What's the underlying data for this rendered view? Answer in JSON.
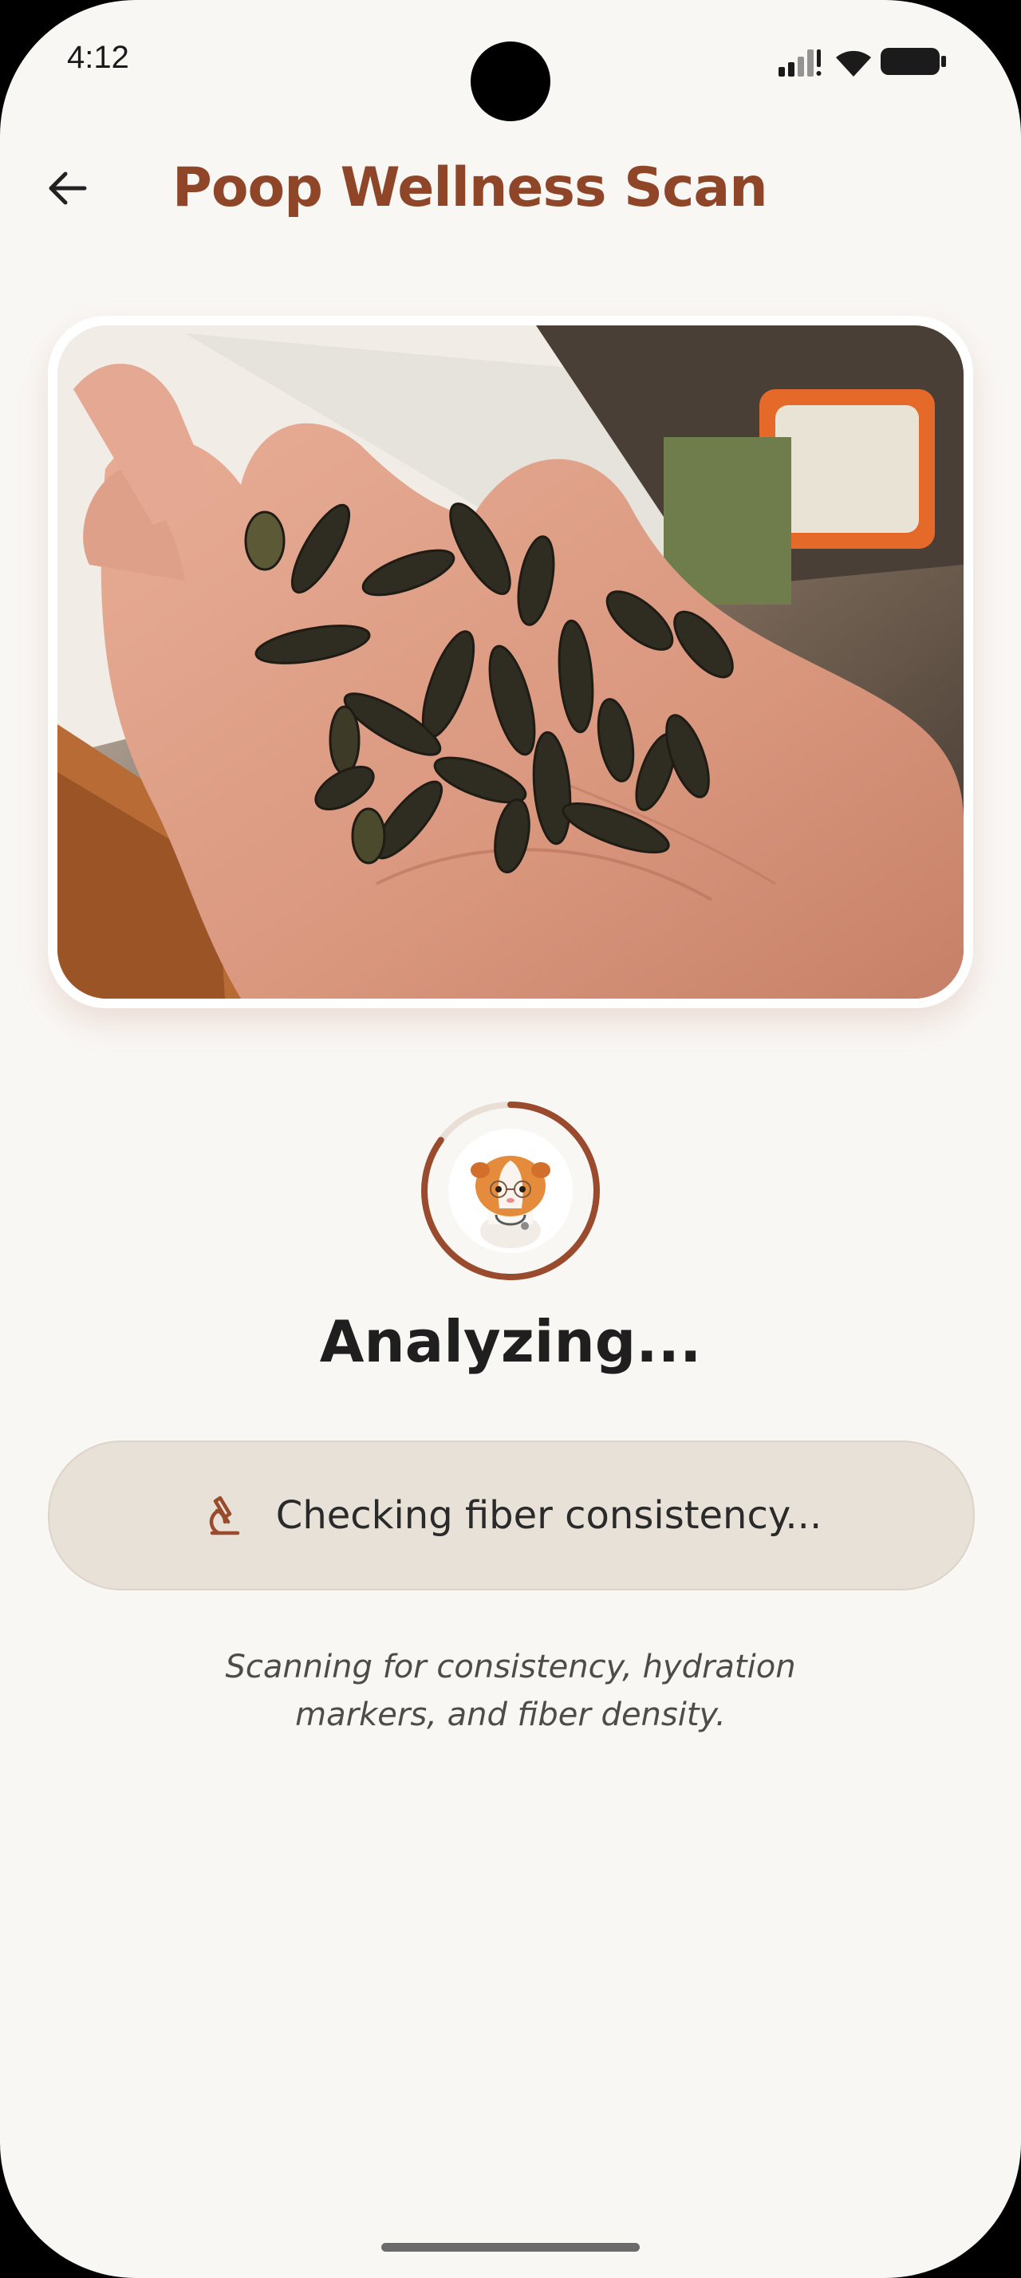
{
  "status_bar": {
    "time": "4:12"
  },
  "header": {
    "back_icon": "arrow-left-icon",
    "title": "Poop Wellness Scan"
  },
  "photo": {
    "subject": "guinea-pig-droppings-in-hand"
  },
  "progress": {
    "label": "Analyzing...",
    "ring_fraction": 0.85,
    "ring_color": "#9a4a2d",
    "avatar": "guinea-pig-doctor-avatar"
  },
  "status_pill": {
    "icon": "microscope-icon",
    "text": "Checking fiber consistency..."
  },
  "description": "Scanning for consistency, hydration markers, and fiber density.",
  "colors": {
    "accent": "#8f4527",
    "background": "#f9f7f4",
    "pill_bg": "#e8e1d8"
  }
}
